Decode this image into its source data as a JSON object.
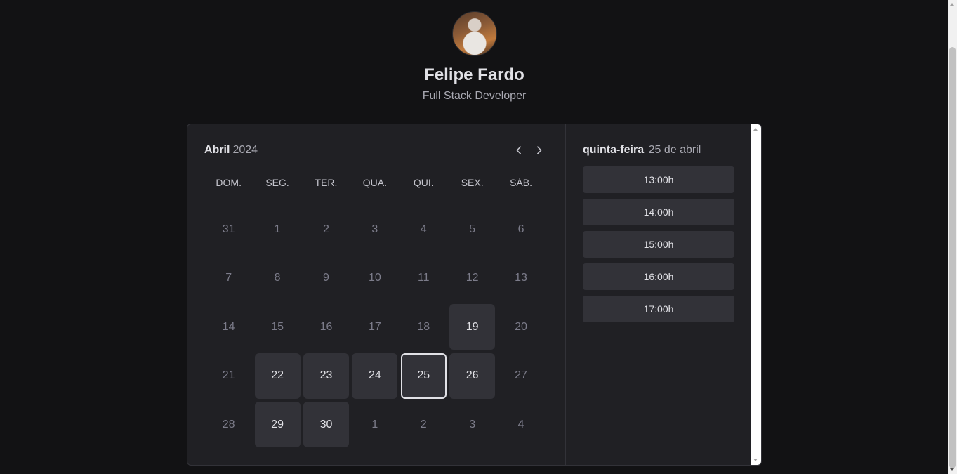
{
  "profile": {
    "name": "Felipe Fardo",
    "role": "Full Stack Developer"
  },
  "calendar": {
    "month": "Abril",
    "year": "2024",
    "weekdays": [
      "DOM.",
      "SEG.",
      "TER.",
      "QUA.",
      "QUI.",
      "SEX.",
      "SÁB."
    ],
    "weeks": [
      [
        {
          "d": "31",
          "s": "disabled"
        },
        {
          "d": "1",
          "s": "disabled"
        },
        {
          "d": "2",
          "s": "disabled"
        },
        {
          "d": "3",
          "s": "disabled"
        },
        {
          "d": "4",
          "s": "disabled"
        },
        {
          "d": "5",
          "s": "disabled"
        },
        {
          "d": "6",
          "s": "disabled"
        }
      ],
      [
        {
          "d": "7",
          "s": "disabled"
        },
        {
          "d": "8",
          "s": "disabled"
        },
        {
          "d": "9",
          "s": "disabled"
        },
        {
          "d": "10",
          "s": "disabled"
        },
        {
          "d": "11",
          "s": "disabled"
        },
        {
          "d": "12",
          "s": "disabled"
        },
        {
          "d": "13",
          "s": "disabled"
        }
      ],
      [
        {
          "d": "14",
          "s": "disabled"
        },
        {
          "d": "15",
          "s": "disabled"
        },
        {
          "d": "16",
          "s": "disabled"
        },
        {
          "d": "17",
          "s": "disabled"
        },
        {
          "d": "18",
          "s": "disabled"
        },
        {
          "d": "19",
          "s": "available"
        },
        {
          "d": "20",
          "s": "disabled"
        }
      ],
      [
        {
          "d": "21",
          "s": "disabled"
        },
        {
          "d": "22",
          "s": "available"
        },
        {
          "d": "23",
          "s": "available"
        },
        {
          "d": "24",
          "s": "available"
        },
        {
          "d": "25",
          "s": "selected"
        },
        {
          "d": "26",
          "s": "available"
        },
        {
          "d": "27",
          "s": "disabled"
        }
      ],
      [
        {
          "d": "28",
          "s": "disabled"
        },
        {
          "d": "29",
          "s": "available"
        },
        {
          "d": "30",
          "s": "available"
        },
        {
          "d": "1",
          "s": "disabled"
        },
        {
          "d": "2",
          "s": "disabled"
        },
        {
          "d": "3",
          "s": "disabled"
        },
        {
          "d": "4",
          "s": "disabled"
        }
      ]
    ],
    "prev_icon": "chevron-left-icon",
    "next_icon": "chevron-right-icon"
  },
  "timepicker": {
    "weekday": "quinta-feira",
    "date": "25 de abril",
    "times": [
      "13:00h",
      "14:00h",
      "15:00h",
      "16:00h",
      "17:00h"
    ]
  },
  "colors": {
    "background": "#121214",
    "panel": "#202024",
    "available_day": "#323238",
    "muted_text": "#7c7c8a"
  }
}
